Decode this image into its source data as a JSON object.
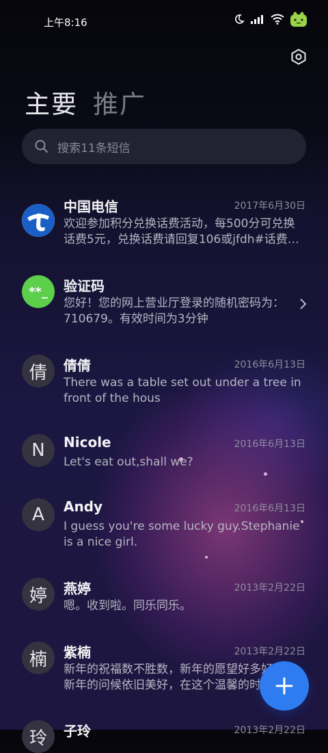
{
  "status_bar": {
    "time": "上午8:16",
    "icons": [
      "moon-icon",
      "signal-icon",
      "wifi-icon",
      "battery-icon"
    ]
  },
  "tabs": [
    {
      "label": "主要",
      "active": true
    },
    {
      "label": "推广",
      "active": false
    }
  ],
  "search": {
    "placeholder": "搜索11条短信",
    "icon": "search-icon"
  },
  "messages": [
    {
      "sender": "中国电信",
      "date": "2017年6月30日",
      "preview": "欢迎参加积分兑换话费活动，每500分可兑换话费5元，兑换话费请回复106或jfdh#话费…",
      "avatar": "china-telecom-logo"
    },
    {
      "sender": "验证码",
      "date": "",
      "preview": "您好！您的网上营业厅登录的随机密码为：710679。有效时间为3分钟",
      "avatar": "**_",
      "avatar_color": "#5ccf4b"
    },
    {
      "sender": "倩倩",
      "date": "2016年6月13日",
      "preview": "There was a table set out under a tree in front of the hous",
      "avatar": "倩"
    },
    {
      "sender": "Nicole",
      "date": "2016年6月13日",
      "preview": "Let's eat out,shall we?",
      "avatar": "N"
    },
    {
      "sender": "Andy",
      "date": "2016年6月13日",
      "preview": "I guess you're some lucky guy.Stephanie is a nice girl.",
      "avatar": "A"
    },
    {
      "sender": "燕婷",
      "date": "2013年2月22日",
      "preview": "嗯。收到啦。同乐同乐。",
      "avatar": "婷"
    },
    {
      "sender": "紫楠",
      "date": "2013年2月22日",
      "preview": "新年的祝福数不胜数，新年的愿望好多好多，新年的问候依旧美好，在这个温馨的时刻",
      "avatar": "楠"
    },
    {
      "sender": "子玲",
      "date": "2013年2月22日",
      "preview": "",
      "avatar": "玲"
    }
  ],
  "fab": {
    "icon": "plus-icon"
  },
  "colors": {
    "accent": "#2f7bf0",
    "verification_avatar": "#5ccf4b"
  }
}
